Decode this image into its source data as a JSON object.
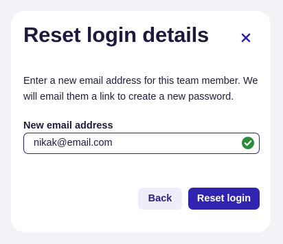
{
  "modal": {
    "title": "Reset login details",
    "description": "Enter a new email address for this team member. We will email them a link to create a new password.",
    "close_icon": "close-icon"
  },
  "email_field": {
    "label": "New email address",
    "value": "nikak@email.com",
    "status_icon": "check-circle-icon",
    "status_color": "#2e8b3a"
  },
  "actions": {
    "back_label": "Back",
    "reset_label": "Reset login"
  },
  "colors": {
    "accent": "#2f23b0",
    "text": "#1c1a3d",
    "secondary_button_bg": "#eeedf8",
    "page_bg": "#f2f2f7"
  }
}
